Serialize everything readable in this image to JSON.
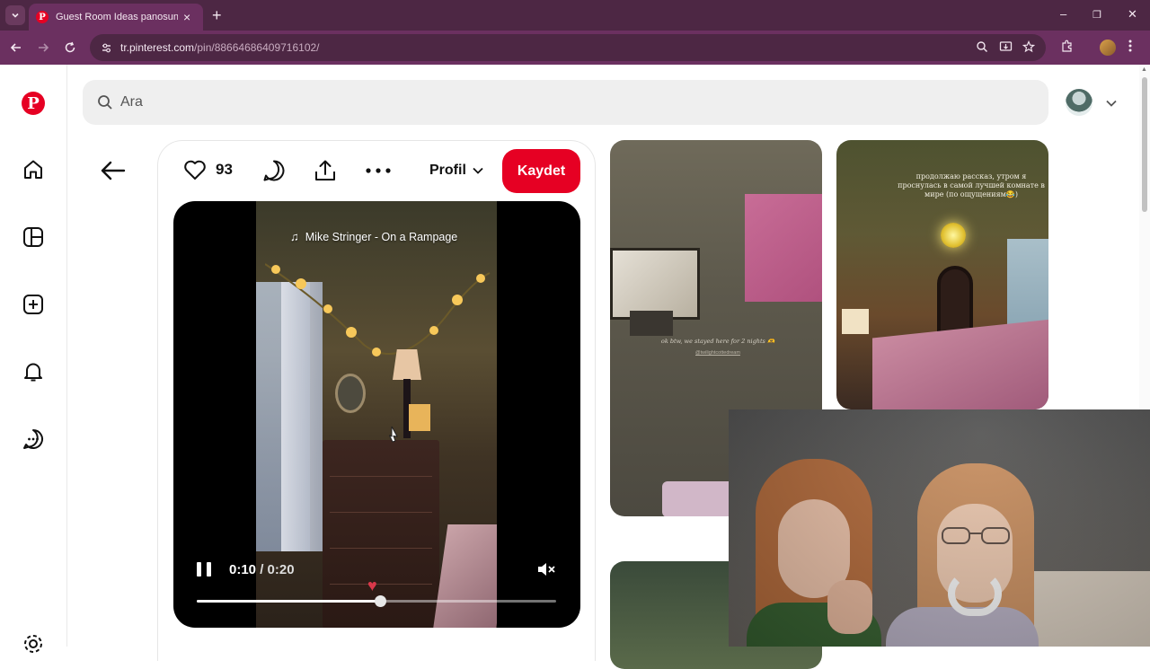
{
  "browser": {
    "tab_title": "Guest Room Ideas panosundaki",
    "tab_close": "×",
    "new_tab": "+",
    "url_host": "tr.pinterest.com",
    "url_path": "/pin/886646864097161​02/",
    "minimize": "–",
    "maximize": "❐",
    "close": "✕"
  },
  "search": {
    "placeholder": "Ara"
  },
  "pin": {
    "like_count": "93",
    "profile_label": "Profil",
    "save_label": "Kaydet",
    "music": "Mike Stringer - On a Rampage",
    "time_current": "0:10",
    "time_separator": " / ",
    "time_total": "0:20",
    "progress": 0.51
  },
  "related": {
    "pin1_caption": "ok btw, we stayed here for 2 nights 🫶",
    "pin1_handle": "@twilightcottedream",
    "pin2_text": "продолжаю рассказ, утром я проснулась в самой лучшей комнате в мире (по ощущениям😂)"
  },
  "colors": {
    "brand": "#e60023",
    "chrome_dark": "#4d2744",
    "chrome": "#6b3060"
  }
}
